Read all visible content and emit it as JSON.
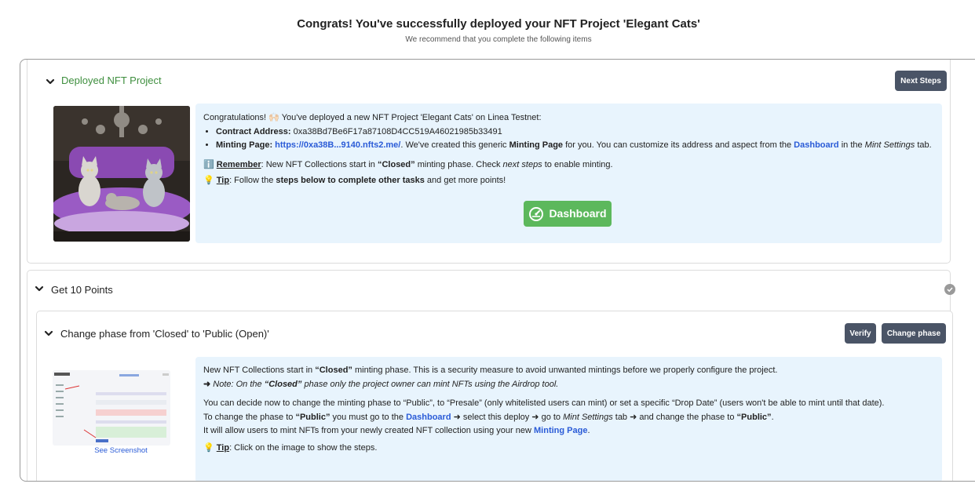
{
  "header": {
    "title": "Congrats! You've successfully deployed your NFT Project 'Elegant Cats'",
    "subtitle": "We recommend that you complete the following items"
  },
  "deployed": {
    "title": "Deployed NFT Project",
    "next_steps_label": "Next Steps",
    "congrats_text": "Congratulations! 🙌🏻 You've deployed a new NFT Project 'Elegant Cats' on Linea Testnet:",
    "contract_label": "Contract Address:",
    "contract_value": "0xa38Bd7Be6F17a87108D4CC519A46021985b33491",
    "minting_label": "Minting Page:",
    "minting_link": "https://0xa38B...9140.nfts2.me/",
    "minting_text_1": ". We've created this generic ",
    "minting_page_bold": "Minting Page",
    "minting_text_2": " for you. You can customize its address and aspect from the ",
    "dashboard_link": "Dashboard",
    "minting_text_3": " in the ",
    "mint_settings_italic": "Mint Settings",
    "minting_text_4": " tab.",
    "remember_icon": "ℹ️",
    "remember_label": "Remember",
    "remember_text_1": ": New NFT Collections start in ",
    "remember_closed": "“Closed”",
    "remember_text_2": " minting phase. Check ",
    "remember_next": "next steps",
    "remember_text_3": " to enable minting.",
    "tip_icon": "💡",
    "tip_label": "Tip",
    "tip_text_1": ": Follow the ",
    "tip_bold": "steps below to complete other tasks",
    "tip_text_2": " and get more points!",
    "dashboard_button": "Dashboard"
  },
  "points": {
    "title": "Get 10 Points",
    "task": {
      "title": "Change phase from 'Closed' to 'Public (Open)'",
      "verify_label": "Verify",
      "change_phase_label": "Change phase",
      "see_screenshot": "See Screenshot",
      "p1_text_1": "New NFT Collections start in ",
      "p1_closed": "“Closed”",
      "p1_text_2": " minting phase. This is a security measure to avoid unwanted mintings before we properly configure the project.",
      "note_arrow": "➜",
      "note_text_1": "Note: On the ",
      "note_closed": "“Closed”",
      "note_text_2": " phase only the project owner can mint NFTs using the Airdrop tool.",
      "p2_text": "You can decide now to change the minting phase to “Public”, to “Presale” (only whitelisted users can mint) or set a specific “Drop Date” (users won't be able to mint until that date).",
      "p3_text_1": "To change the phase to ",
      "p3_public": "“Public”",
      "p3_text_2": " you must go to the ",
      "p3_dashboard": "Dashboard",
      "p3_text_3": " ➜ select this deploy ➜ go to ",
      "p3_mint_settings": "Mint Settings",
      "p3_text_4": " tab ➜ and change the phase to ",
      "p3_public2": "“Public”",
      "p3_text_5": ".",
      "p4_text_1": "It will allow users to mint NFTs from your newly created NFT collection using your new ",
      "p4_minting_page": "Minting Page",
      "p4_text_2": ".",
      "tip_icon": "💡",
      "tip_label": "Tip",
      "tip_text": ": Click on the image to show the steps."
    }
  },
  "colors": {
    "accent_green": "#5cb85c",
    "section_green": "#3f8f3f",
    "dark_button": "#4a5466",
    "info_bg": "#e8f4fd",
    "link_blue": "#2a5bd7"
  }
}
